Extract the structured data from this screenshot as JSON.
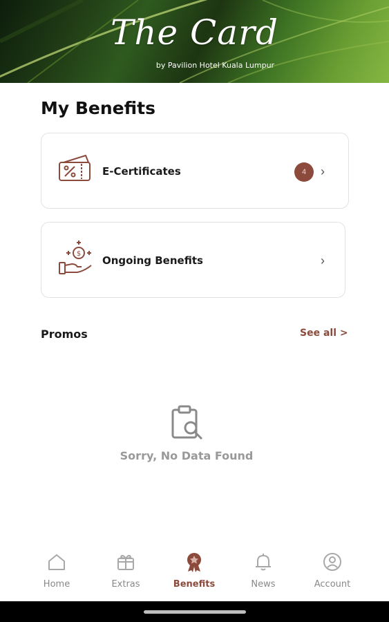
{
  "header": {
    "title": "The Card",
    "subtitle": "by Pavilion Hotel Kuala Lumpur"
  },
  "page_title": "My Benefits",
  "benefits": [
    {
      "label": "E-Certificates",
      "icon": "discount-ticket-icon",
      "badge": "4"
    },
    {
      "label": "Ongoing Benefits",
      "icon": "money-hand-icon"
    }
  ],
  "promos": {
    "label": "Promos",
    "see_all": "See all >",
    "empty_text": "Sorry, No Data Found",
    "empty_icon": "clipboard-search-icon"
  },
  "nav": {
    "items": [
      {
        "label": "Home",
        "icon": "home-icon"
      },
      {
        "label": "Extras",
        "icon": "gift-icon"
      },
      {
        "label": "Benefits",
        "icon": "badge-icon",
        "active": true
      },
      {
        "label": "News",
        "icon": "bell-icon"
      },
      {
        "label": "Account",
        "icon": "account-icon"
      }
    ]
  },
  "colors": {
    "accent": "#8b4a3c",
    "muted": "#888888",
    "card_border": "#e2e2e2"
  }
}
